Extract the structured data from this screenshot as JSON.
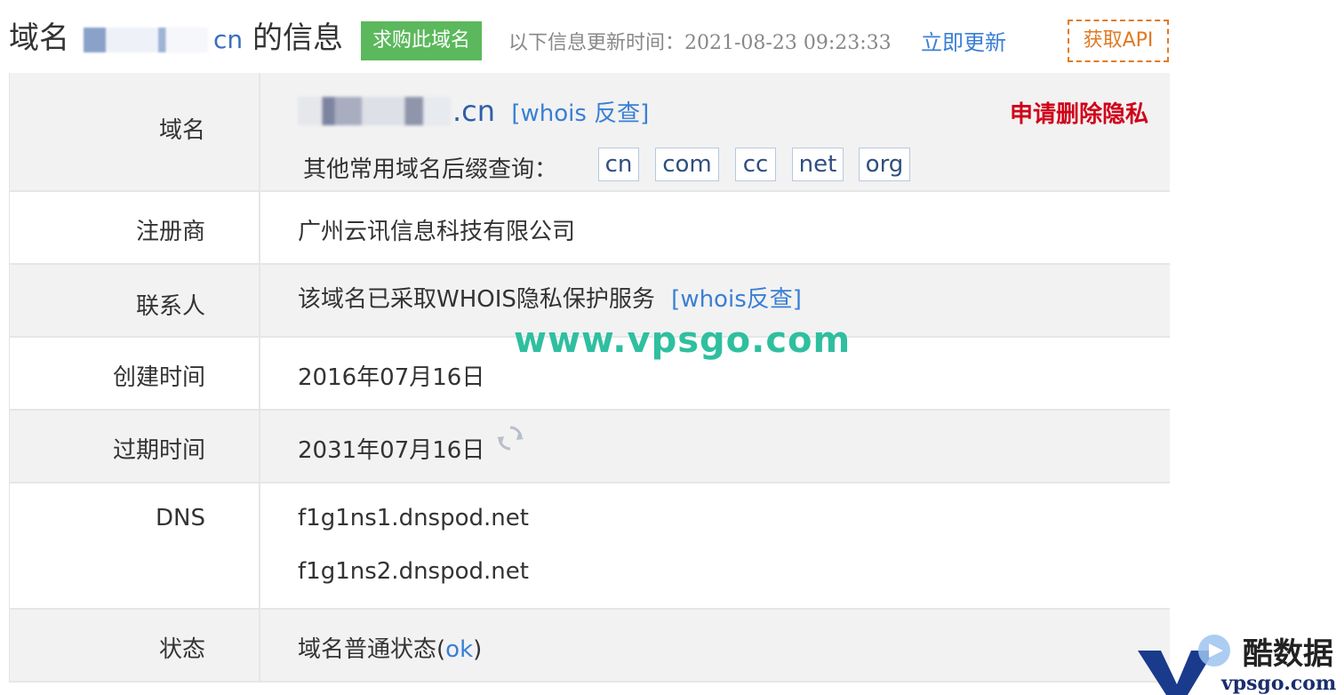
{
  "header": {
    "title_prefix": "域名",
    "title_domain_tld": "cn",
    "title_suffix": "的信息",
    "buy_button": "求购此域名",
    "update_label": "以下信息更新时间：2021-08-23 09:23:33",
    "update_link": "立即更新",
    "api_button": "获取API"
  },
  "rows": {
    "domain": {
      "label": "域名",
      "value_tld": ".cn",
      "whois_link": "[whois 反查]",
      "privacy_link": "申请删除隐私",
      "suffix_label": "其他常用域名后缀查询：",
      "suffixes": [
        "cn",
        "com",
        "cc",
        "net",
        "org"
      ]
    },
    "registrar": {
      "label": "注册商",
      "value": "广州云讯信息科技有限公司"
    },
    "contact": {
      "label": "联系人",
      "value": "该域名已采取WHOIS隐私保护服务",
      "whois_link": "[whois反查]"
    },
    "created": {
      "label": "创建时间",
      "value": "2016年07月16日"
    },
    "expires": {
      "label": "过期时间",
      "value": "2031年07月16日"
    },
    "dns": {
      "label": "DNS",
      "servers": [
        "f1g1ns1.dnspod.net",
        "f1g1ns2.dnspod.net"
      ]
    },
    "status": {
      "label": "状态",
      "value_prefix": "域名普通状态(",
      "value_link": "ok",
      "value_suffix": ")"
    }
  },
  "watermark": "www.vpsgo.com",
  "logo": {
    "name": "酷数据",
    "site": "vpsgo.com"
  },
  "colors": {
    "buy_green": "#5cb85c",
    "link_blue": "#3a7fd5",
    "api_orange": "#e07b24",
    "privacy_red": "#d0021b"
  }
}
